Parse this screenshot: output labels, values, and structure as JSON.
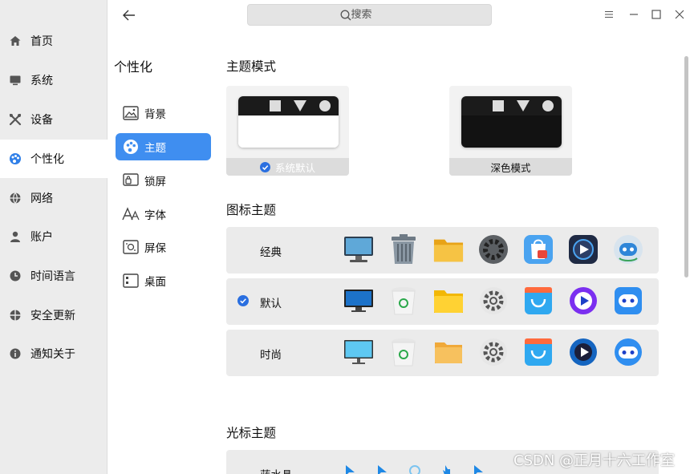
{
  "nav": {
    "items": [
      {
        "label": "首页",
        "icon": "home-icon"
      },
      {
        "label": "系统",
        "icon": "monitor-icon"
      },
      {
        "label": "设备",
        "icon": "tools-icon"
      },
      {
        "label": "个性化",
        "icon": "palette-icon",
        "active": true
      },
      {
        "label": "网络",
        "icon": "globe-icon"
      },
      {
        "label": "账户",
        "icon": "user-icon"
      },
      {
        "label": "时间语言",
        "icon": "clock-icon"
      },
      {
        "label": "安全更新",
        "icon": "shield-icon"
      },
      {
        "label": "通知关于",
        "icon": "info-icon"
      }
    ]
  },
  "subnav": {
    "title": "个性化",
    "items": [
      {
        "label": "背景",
        "icon": "picture-icon"
      },
      {
        "label": "主题",
        "icon": "palette-icon",
        "active": true
      },
      {
        "label": "锁屏",
        "icon": "lockscreen-icon"
      },
      {
        "label": "字体",
        "icon": "font-icon"
      },
      {
        "label": "屏保",
        "icon": "screensaver-icon"
      },
      {
        "label": "桌面",
        "icon": "desktop-grid-icon"
      }
    ]
  },
  "search": {
    "placeholder": "搜索"
  },
  "theme_mode": {
    "title": "主题模式",
    "options": [
      {
        "label": "系统默认",
        "selected": true
      },
      {
        "label": "深色模式",
        "selected": false
      }
    ]
  },
  "icon_theme": {
    "title": "图标主题",
    "rows": [
      {
        "label": "经典",
        "selected": false
      },
      {
        "label": "默认",
        "selected": true
      },
      {
        "label": "时尚",
        "selected": false
      }
    ]
  },
  "cursor_theme": {
    "title": "光标主题",
    "first_row_label": "蓝水晶"
  },
  "watermark": "CSDN @正月十六工作室",
  "colors": {
    "accent": "#3f8ef0",
    "check": "#2a6fe0"
  }
}
